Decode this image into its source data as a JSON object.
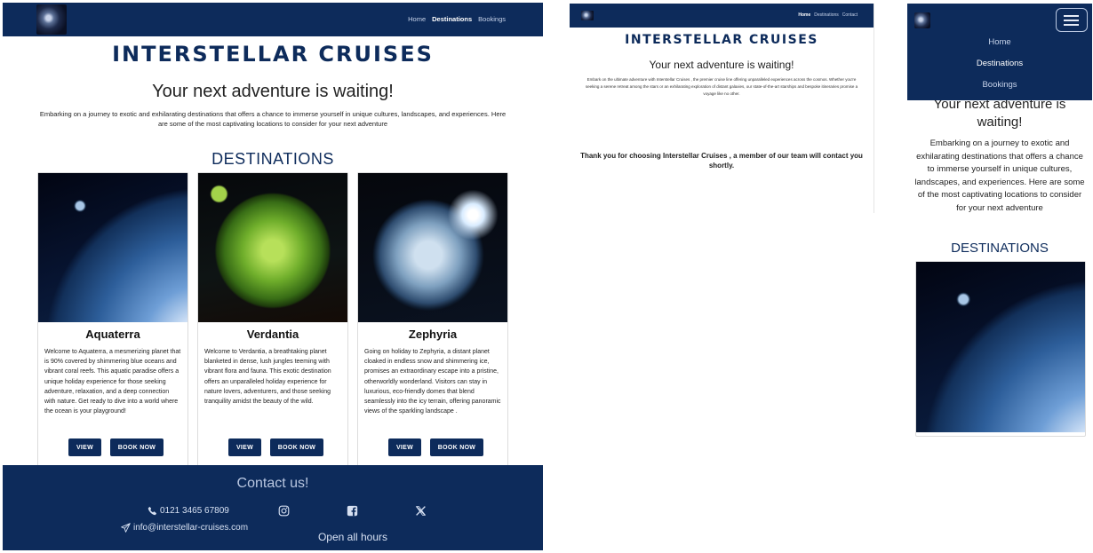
{
  "nav": {
    "home": "Home",
    "destinations": "Destinations",
    "bookings": "Bookings",
    "contact": "Contact"
  },
  "brand": "INTERSTELLAR CRUISES",
  "tagline": "Your next adventure is waiting!",
  "intro_main": "Embarking on a journey to exotic and exhilarating destinations that offers a chance to immerse yourself in unique cultures, landscapes, and experiences. Here are some of the most captivating locations to consider for your next adventure",
  "intro_tablet": "Embark on the ultimate adventure with Interstellar Cruises , the premier cruise line offering unparalleled experiences across the cosmos. Whether you're seeking a serene retreat among the stars or an exhilarating exploration of distant galaxies, our state-of-the-art starships and bespoke itineraries promise a voyage like no other.",
  "destinations_heading": "DESTINATIONS",
  "cards": [
    {
      "title": "Aquaterra",
      "text": "Welcome to Aquaterra, a mesmerizing planet that is 90% covered by shimmering blue oceans and vibrant coral reefs. This aquatic paradise offers a unique holiday experience for those seeking adventure, relaxation, and a deep connection with nature. Get ready to dive into a world where the ocean is your playground!",
      "view": "VIEW",
      "book": "BOOK NOW"
    },
    {
      "title": "Verdantia",
      "text": "Welcome to Verdantia, a breathtaking planet blanketed in dense, lush jungles teeming with vibrant flora and fauna. This exotic destination offers an unparalleled holiday experience for nature lovers, adventurers, and those seeking tranquility amidst the beauty of the wild.",
      "view": "VIEW",
      "book": "BOOK NOW"
    },
    {
      "title": "Zephyria",
      "text": "Going on holiday to Zephyria, a distant planet cloaked in endless snow and shimmering ice, promises an extraordinary escape into a pristine, otherworldly wonderland. Visitors can stay in luxurious, eco-friendly domes that blend seamlessly into the icy terrain, offering panoramic views of the sparkling landscape .",
      "view": "VIEW",
      "book": "BOOK NOW"
    }
  ],
  "footer": {
    "heading": "Contact us!",
    "phone": "0121 3465 67809",
    "email": "info@interstellar-cruises.com",
    "hours": "Open all hours"
  },
  "thanks": "Thank you for choosing Interstellar Cruises , a member of our team will contact you shortly.",
  "colors": {
    "navy": "#0d2b5b",
    "footer_text": "#d6e0f2"
  },
  "icons": [
    "phone-icon",
    "send-icon",
    "instagram-icon",
    "facebook-icon",
    "x-icon",
    "menu-icon"
  ]
}
